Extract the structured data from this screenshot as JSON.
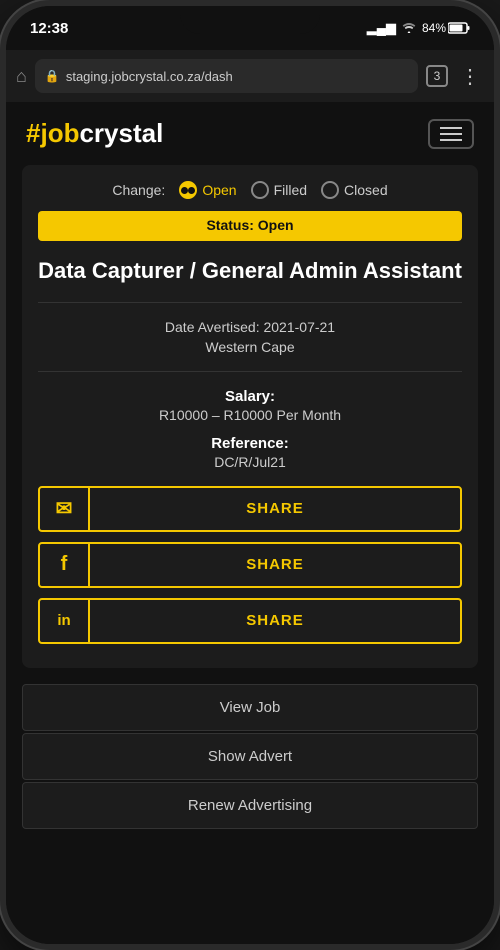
{
  "statusBar": {
    "time": "12:38",
    "signal": "▂▄▆",
    "wifi": "WiFi",
    "battery": "84%"
  },
  "browser": {
    "url": "staging.jobcrystal.co.za/dash",
    "tabCount": "3"
  },
  "header": {
    "logoHash": "#",
    "logoJob": "job",
    "logoCrystal": "crystal",
    "menuLabel": "Menu"
  },
  "statusToggle": {
    "changeLabel": "Change:",
    "options": [
      {
        "id": "open",
        "label": "Open",
        "selected": true
      },
      {
        "id": "filled",
        "label": "Filled",
        "selected": false
      },
      {
        "id": "closed",
        "label": "Closed",
        "selected": false
      }
    ]
  },
  "statusBanner": {
    "text": "Status: Open"
  },
  "jobTitle": "Data Capturer / General Admin Assistant",
  "jobMeta": {
    "dateLabel": "Date Avertised: 2021-07-21",
    "location": "Western Cape"
  },
  "salary": {
    "label": "Salary:",
    "value": "R10000 – R10000 Per Month"
  },
  "reference": {
    "label": "Reference:",
    "value": "DC/R/Jul21"
  },
  "shareButtons": [
    {
      "id": "email",
      "icon": "✉",
      "label": "SHARE"
    },
    {
      "id": "facebook",
      "icon": "f",
      "label": "SHARE"
    },
    {
      "id": "linkedin",
      "icon": "in",
      "label": "SHARE"
    }
  ],
  "actionButtons": [
    {
      "id": "view-job",
      "label": "View Job"
    },
    {
      "id": "show-advert",
      "label": "Show Advert"
    },
    {
      "id": "renew-advertising",
      "label": "Renew Advertising"
    }
  ]
}
